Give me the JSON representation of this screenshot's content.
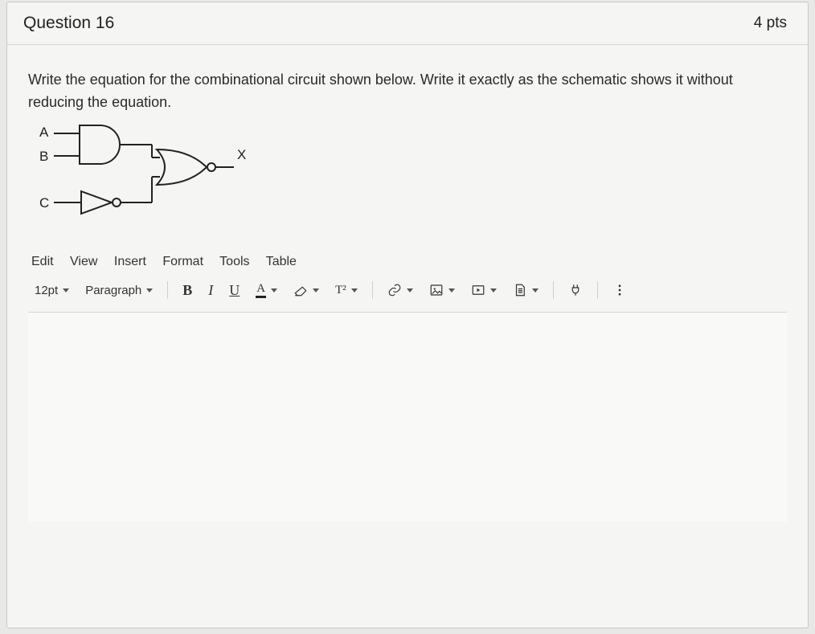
{
  "header": {
    "title": "Question 16",
    "points": "4 pts"
  },
  "prompt": {
    "line1": "Write the equation for the combinational circuit shown below.  Write it exactly as the schematic shows it without",
    "line2": "reducing the equation."
  },
  "circuit": {
    "input_a": "A",
    "input_b": "B",
    "input_c": "C",
    "output": "X"
  },
  "menus": {
    "edit": "Edit",
    "view": "View",
    "insert": "Insert",
    "format": "Format",
    "tools": "Tools",
    "table": "Table"
  },
  "toolbar": {
    "font_size": "12pt",
    "block_format": "Paragraph",
    "bold": "B",
    "italic": "I",
    "underline": "U",
    "text_color": "A",
    "superscript": "T²"
  }
}
